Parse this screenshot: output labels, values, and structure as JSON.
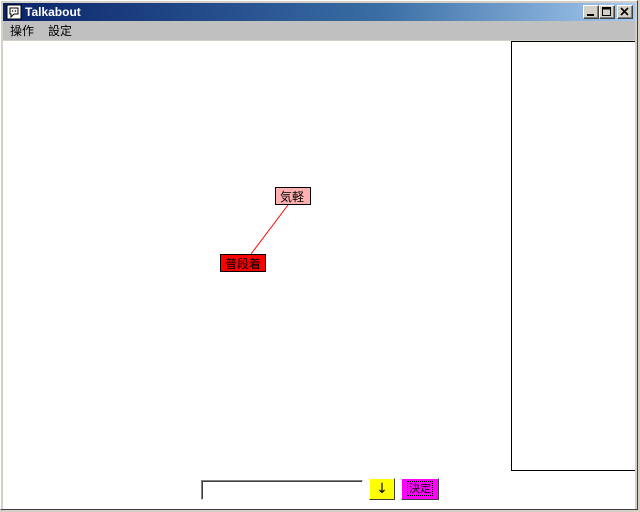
{
  "window": {
    "title": "Talkabout"
  },
  "menubar": {
    "items": [
      {
        "label": "操作"
      },
      {
        "label": "設定"
      }
    ]
  },
  "canvas": {
    "nodes": [
      {
        "label": "気軽",
        "color": "#ffb0b0"
      },
      {
        "label": "普段着",
        "color": "#ff0000"
      }
    ],
    "edge_color": "#ff0000"
  },
  "input_bar": {
    "text_value": "",
    "arrow_label": "↓",
    "arrow_color": "#ffff00",
    "decide_label": "決定",
    "decide_color": "#ff00ff"
  }
}
